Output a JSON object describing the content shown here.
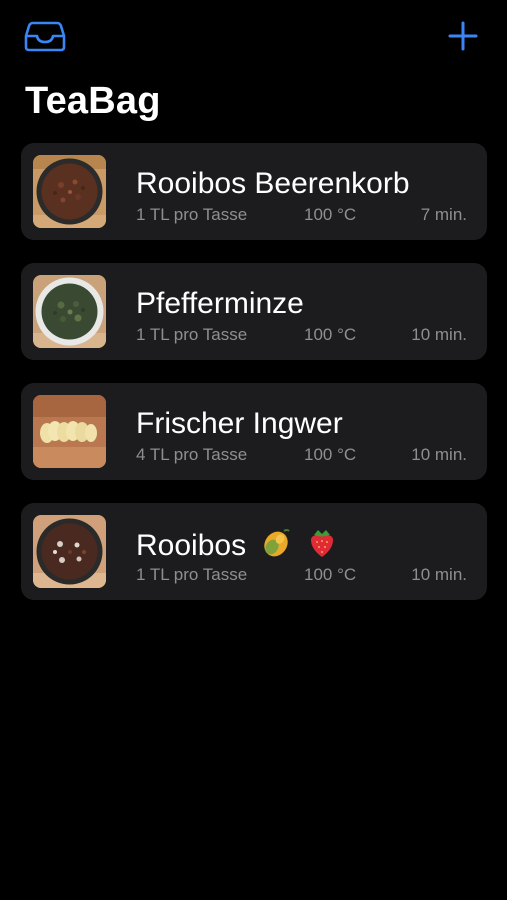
{
  "app": {
    "title": "TeaBag",
    "accent_color": "#3a86f5",
    "left_icon": "tray-icon",
    "right_icon": "plus-icon"
  },
  "teas": [
    {
      "name": "Rooibos Beerenkorb",
      "amount": "1 TL pro Tasse",
      "temperature": "100 °C",
      "time": "7 min.",
      "thumbnail": "rooibos-bowl"
    },
    {
      "name": "Pfefferminze",
      "amount": "1 TL pro Tasse",
      "temperature": "100 °C",
      "time": "10 min.",
      "thumbnail": "peppermint-bowl"
    },
    {
      "name": "Frischer Ingwer",
      "amount": "4 TL pro Tasse",
      "temperature": "100 °C",
      "time": "10 min.",
      "thumbnail": "ginger-slices"
    },
    {
      "name": "Rooibos",
      "amount": "1 TL pro Tasse",
      "temperature": "100 °C",
      "time": "10 min.",
      "thumbnail": "rooibos-bowl",
      "name_icons": [
        "mango-icon",
        "strawberry-icon"
      ]
    }
  ]
}
